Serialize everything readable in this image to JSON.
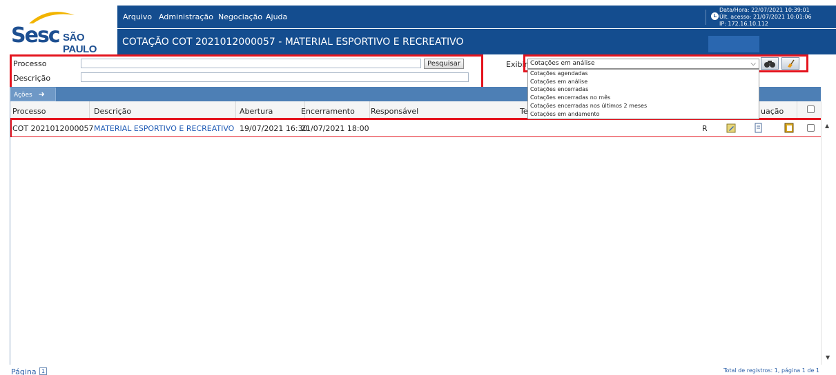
{
  "brand": {
    "logo": "Sesc",
    "logo_sub": "SÃO PAULO"
  },
  "menu": [
    "Arquivo",
    "Administração",
    "Negociação",
    "Ajuda"
  ],
  "page_title": "COTAÇÃO COT 2021012000057 - MATERIAL ESPORTIVO E RECREATIVO",
  "session": {
    "datetime": "Data/Hora: 22/07/2021 10:39:01",
    "last_access": "Últ. acesso: 21/07/2021 10:01:06",
    "ip": "IP: 172.16.10.112"
  },
  "filters": {
    "processo_label": "Processo",
    "descricao_label": "Descrição",
    "search_button": "Pesquisar",
    "exibir_label": "Exibir",
    "exibir_value": "Cotações em análise",
    "exibir_options": [
      "Cotações agendadas",
      "Cotações em análise",
      "Cotações encerradas",
      "Cotações encerradas no mês",
      "Cotações encerradas nos últimos 2 meses",
      "Cotações em andamento"
    ]
  },
  "toolbar": {
    "acoes_label": "Ações"
  },
  "table": {
    "headers": [
      "Processo",
      "Descrição",
      "Abertura",
      "Encerramento",
      "Responsável",
      "Te",
      "uação"
    ],
    "rows": [
      {
        "processo": "COT 2021012000057",
        "descricao": "MATERIAL ESPORTIVO E RECREATIVO",
        "abertura": "19/07/2021 16:30",
        "encerramento": "21/07/2021 18:00",
        "responsavel": "",
        "flag": "R"
      }
    ]
  },
  "footer": {
    "page_label": "Página",
    "page_number": "1",
    "total": "Total de registros: 1, página 1 de 1"
  },
  "colors": {
    "header_blue": "#144d8f",
    "highlight_red": "#e4131d",
    "link_blue": "#1f5bb5"
  },
  "icons": [
    "clock-icon",
    "binoculars-icon",
    "clear-filter-icon",
    "edit-icon",
    "document-icon",
    "clipboard-icon",
    "arrow-right-icon"
  ]
}
